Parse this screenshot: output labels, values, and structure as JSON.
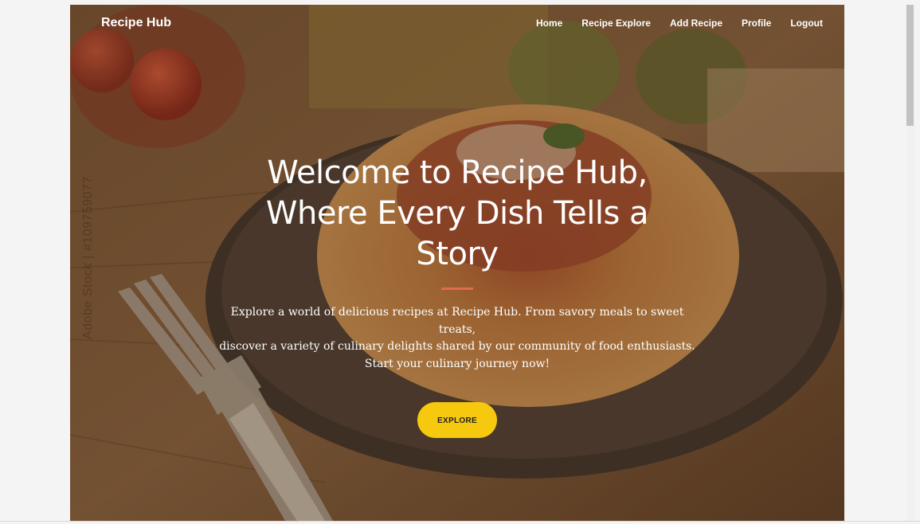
{
  "navbar": {
    "brand": "Recipe Hub",
    "links": [
      "Home",
      "Recipe Explore",
      "Add Recipe",
      "Profile",
      "Logout"
    ]
  },
  "hero": {
    "title": "Welcome to Recipe Hub, Where Every Dish Tells a Story",
    "description_line1": "Explore a world of delicious recipes at Recipe Hub. From savory meals to sweet treats,",
    "description_line2": "discover a variety of culinary delights shared by our community of food enthusiasts.",
    "description_line3": "Start your culinary journey now!",
    "button_label": "EXPLORE"
  },
  "watermark": "Adobe Stock | #109759077",
  "colors": {
    "accent_button": "#f6c90e",
    "divider": "#e26b4a"
  }
}
